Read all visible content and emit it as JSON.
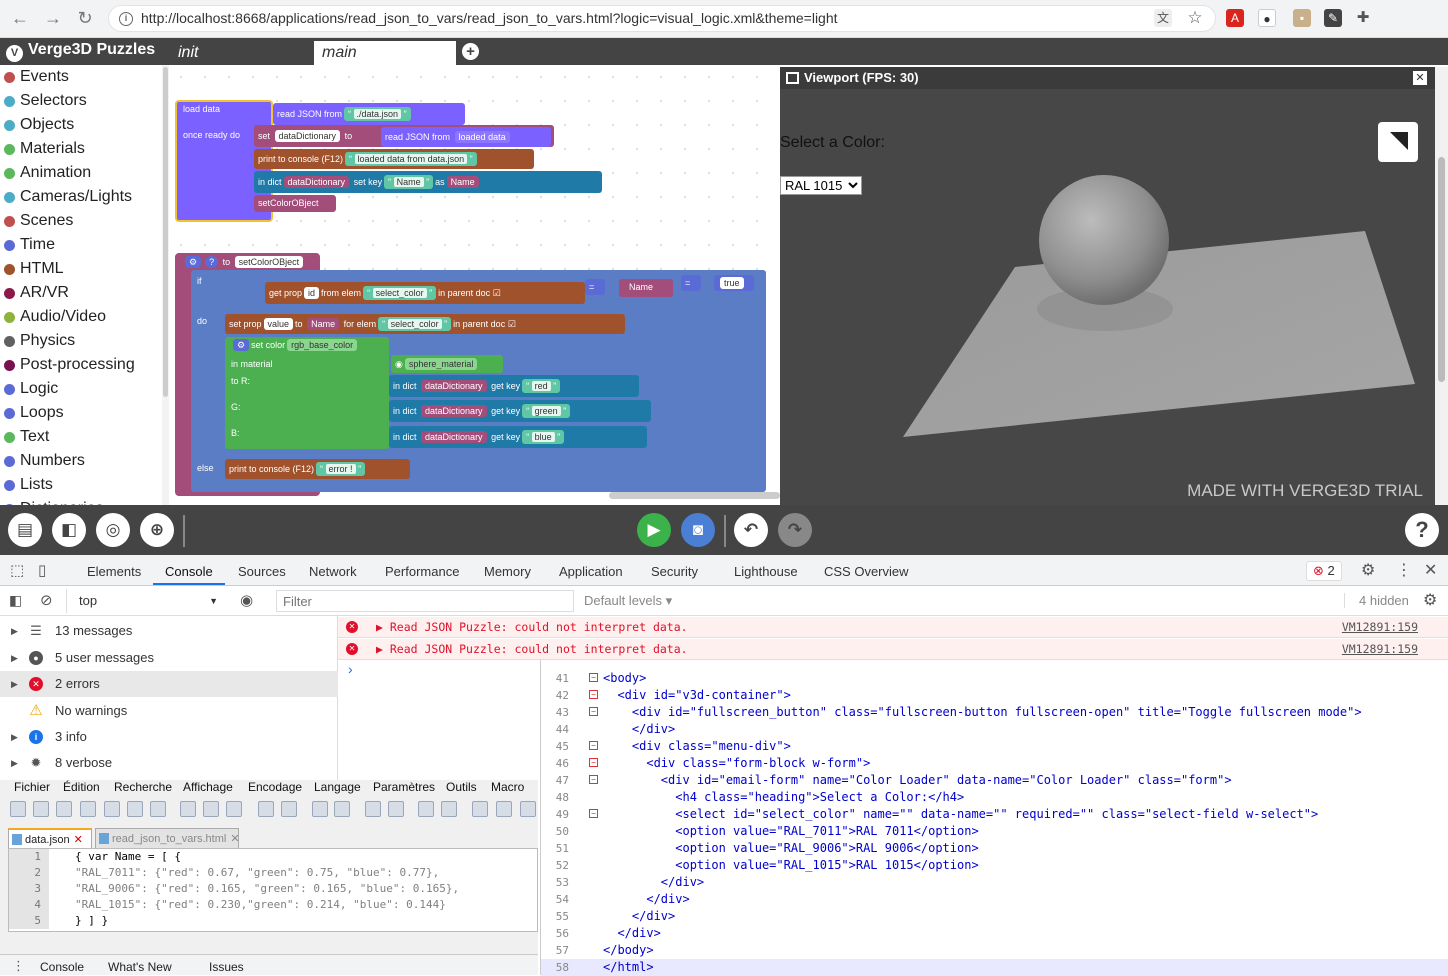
{
  "browser": {
    "url": "http://localhost:8668/applications/read_json_to_vars/read_json_to_vars.html?logic=visual_logic.xml&theme=light"
  },
  "puzzles": {
    "title": "Verge3D Puzzles",
    "tabs": [
      "init",
      "main"
    ],
    "categories": [
      {
        "label": "Events",
        "color": "#c0504d"
      },
      {
        "label": "Selectors",
        "color": "#4bacc6"
      },
      {
        "label": "Objects",
        "color": "#4bacc6"
      },
      {
        "label": "Materials",
        "color": "#5cb85c"
      },
      {
        "label": "Animation",
        "color": "#5cb85c"
      },
      {
        "label": "Cameras/Lights",
        "color": "#4bacc6"
      },
      {
        "label": "Scenes",
        "color": "#c0504d"
      },
      {
        "label": "Time",
        "color": "#5b6bd6"
      },
      {
        "label": "HTML",
        "color": "#a0522d"
      },
      {
        "label": "AR/VR",
        "color": "#8b1a4a"
      },
      {
        "label": "Audio/Video",
        "color": "#8db33a"
      },
      {
        "label": "Physics",
        "color": "#606060"
      },
      {
        "label": "Post-processing",
        "color": "#7a1050"
      },
      {
        "label": "Logic",
        "color": "#5b6bd6"
      },
      {
        "label": "Loops",
        "color": "#5b6bd6"
      },
      {
        "label": "Text",
        "color": "#5cb85c"
      },
      {
        "label": "Numbers",
        "color": "#5b6bd6"
      },
      {
        "label": "Lists",
        "color": "#5b6bd6"
      },
      {
        "label": "Dictionaries",
        "color": "#5b6bd6"
      }
    ],
    "blocks": {
      "load_data": "load data",
      "once_ready": "once ready do",
      "read_json": "read JSON from",
      "data_json": "./data.json",
      "set": "set",
      "dataDictionary": "dataDictionary",
      "to": "to",
      "loaded_data": "loaded data",
      "print": "print to console (F12)",
      "loaded_msg": "loaded data from data.json",
      "in_dict": "in dict",
      "set_key": "set key",
      "name": "Name",
      "as": "as",
      "setColorObject": "setColorOBject",
      "to_fn": "to",
      "if": "if",
      "do": "do",
      "else": "else",
      "get_prop": "get prop",
      "id": "id",
      "from_elem": "from elem",
      "select_color": "select_color",
      "in_parent_doc": "in parent doc",
      "eq": "=",
      "true": "true",
      "set_prop": "set prop",
      "value": "value",
      "for_elem": "for elem",
      "set_color": "set color",
      "rgb_base_color": "rgb_base_color",
      "in_material": "in material",
      "sphere_material": "sphere_material",
      "to_r": "to R:",
      "g": "G:",
      "b": "B:",
      "get_key": "get key",
      "red": "red",
      "green": "green",
      "blue": "blue",
      "error": "error !"
    }
  },
  "viewport": {
    "title": "Viewport (FPS: 30)",
    "label": "Select a Color:",
    "selected": "RAL 1015",
    "watermark": "MADE WITH VERGE3D TRIAL"
  },
  "devtools": {
    "tabs": [
      "Elements",
      "Console",
      "Sources",
      "Network",
      "Performance",
      "Memory",
      "Application",
      "Security",
      "Lighthouse",
      "CSS Overview"
    ],
    "error_count": "2",
    "context": "top",
    "filter_placeholder": "Filter",
    "levels": "Default levels",
    "hidden": "4 hidden",
    "sidebar": [
      "13 messages",
      "5 user messages",
      "2 errors",
      "No warnings",
      "3 info",
      "8 verbose"
    ],
    "errors": [
      {
        "msg": "Read JSON Puzzle: could not interpret data.",
        "src": "VM12891:159"
      },
      {
        "msg": "Read JSON Puzzle: could not interpret data.",
        "src": "VM12891:159"
      }
    ],
    "drawer": [
      "Console",
      "What's New",
      "Issues"
    ]
  },
  "notepad": {
    "menu": [
      "Fichier",
      "Édition",
      "Recherche",
      "Affichage",
      "Encodage",
      "Langage",
      "Paramètres",
      "Outils",
      "Macro"
    ],
    "tabs": [
      "data.json",
      "read_json_to_vars.html"
    ],
    "lines": [
      {
        "n": "1",
        "t": "{ var Name = [ {"
      },
      {
        "n": "2",
        "t": "\"RAL_7011\": {\"red\": 0.67, \"green\": 0.75, \"blue\": 0.77},"
      },
      {
        "n": "3",
        "t": "\"RAL_9006\": {\"red\": 0.165, \"green\": 0.165, \"blue\": 0.165},"
      },
      {
        "n": "4",
        "t": "\"RAL_1015\": {\"red\": 0.230,\"green\": 0.214, \"blue\": 0.144}"
      },
      {
        "n": "5",
        "t": "} ] }"
      }
    ]
  },
  "code": {
    "lines": [
      {
        "n": "41",
        "t": "<body>"
      },
      {
        "n": "42",
        "t": "  <div id=\"v3d-container\">"
      },
      {
        "n": "43",
        "t": "    <div id=\"fullscreen_button\" class=\"fullscreen-button fullscreen-open\" title=\"Toggle fullscreen mode\">"
      },
      {
        "n": "44",
        "t": "    </div>"
      },
      {
        "n": "45",
        "t": "    <div class=\"menu-div\">"
      },
      {
        "n": "46",
        "t": "      <div class=\"form-block w-form\">"
      },
      {
        "n": "47",
        "t": "        <div id=\"email-form\" name=\"Color Loader\" data-name=\"Color Loader\" class=\"form\">"
      },
      {
        "n": "48",
        "t": "          <h4 class=\"heading\">Select a Color:</h4>"
      },
      {
        "n": "49",
        "t": "          <select id=\"select_color\" name=\"\" data-name=\"\" required=\"\" class=\"select-field w-select\">"
      },
      {
        "n": "50",
        "t": "          <option value=\"RAL_7011\">RAL 7011</option>"
      },
      {
        "n": "51",
        "t": "          <option value=\"RAL_9006\">RAL 9006</option>"
      },
      {
        "n": "52",
        "t": "          <option value=\"RAL_1015\">RAL 1015</option>"
      },
      {
        "n": "53",
        "t": "        </div>"
      },
      {
        "n": "54",
        "t": "      </div>"
      },
      {
        "n": "55",
        "t": "    </div>"
      },
      {
        "n": "56",
        "t": "  </div>"
      },
      {
        "n": "57",
        "t": "</body>"
      },
      {
        "n": "58",
        "t": "</html>"
      }
    ]
  }
}
